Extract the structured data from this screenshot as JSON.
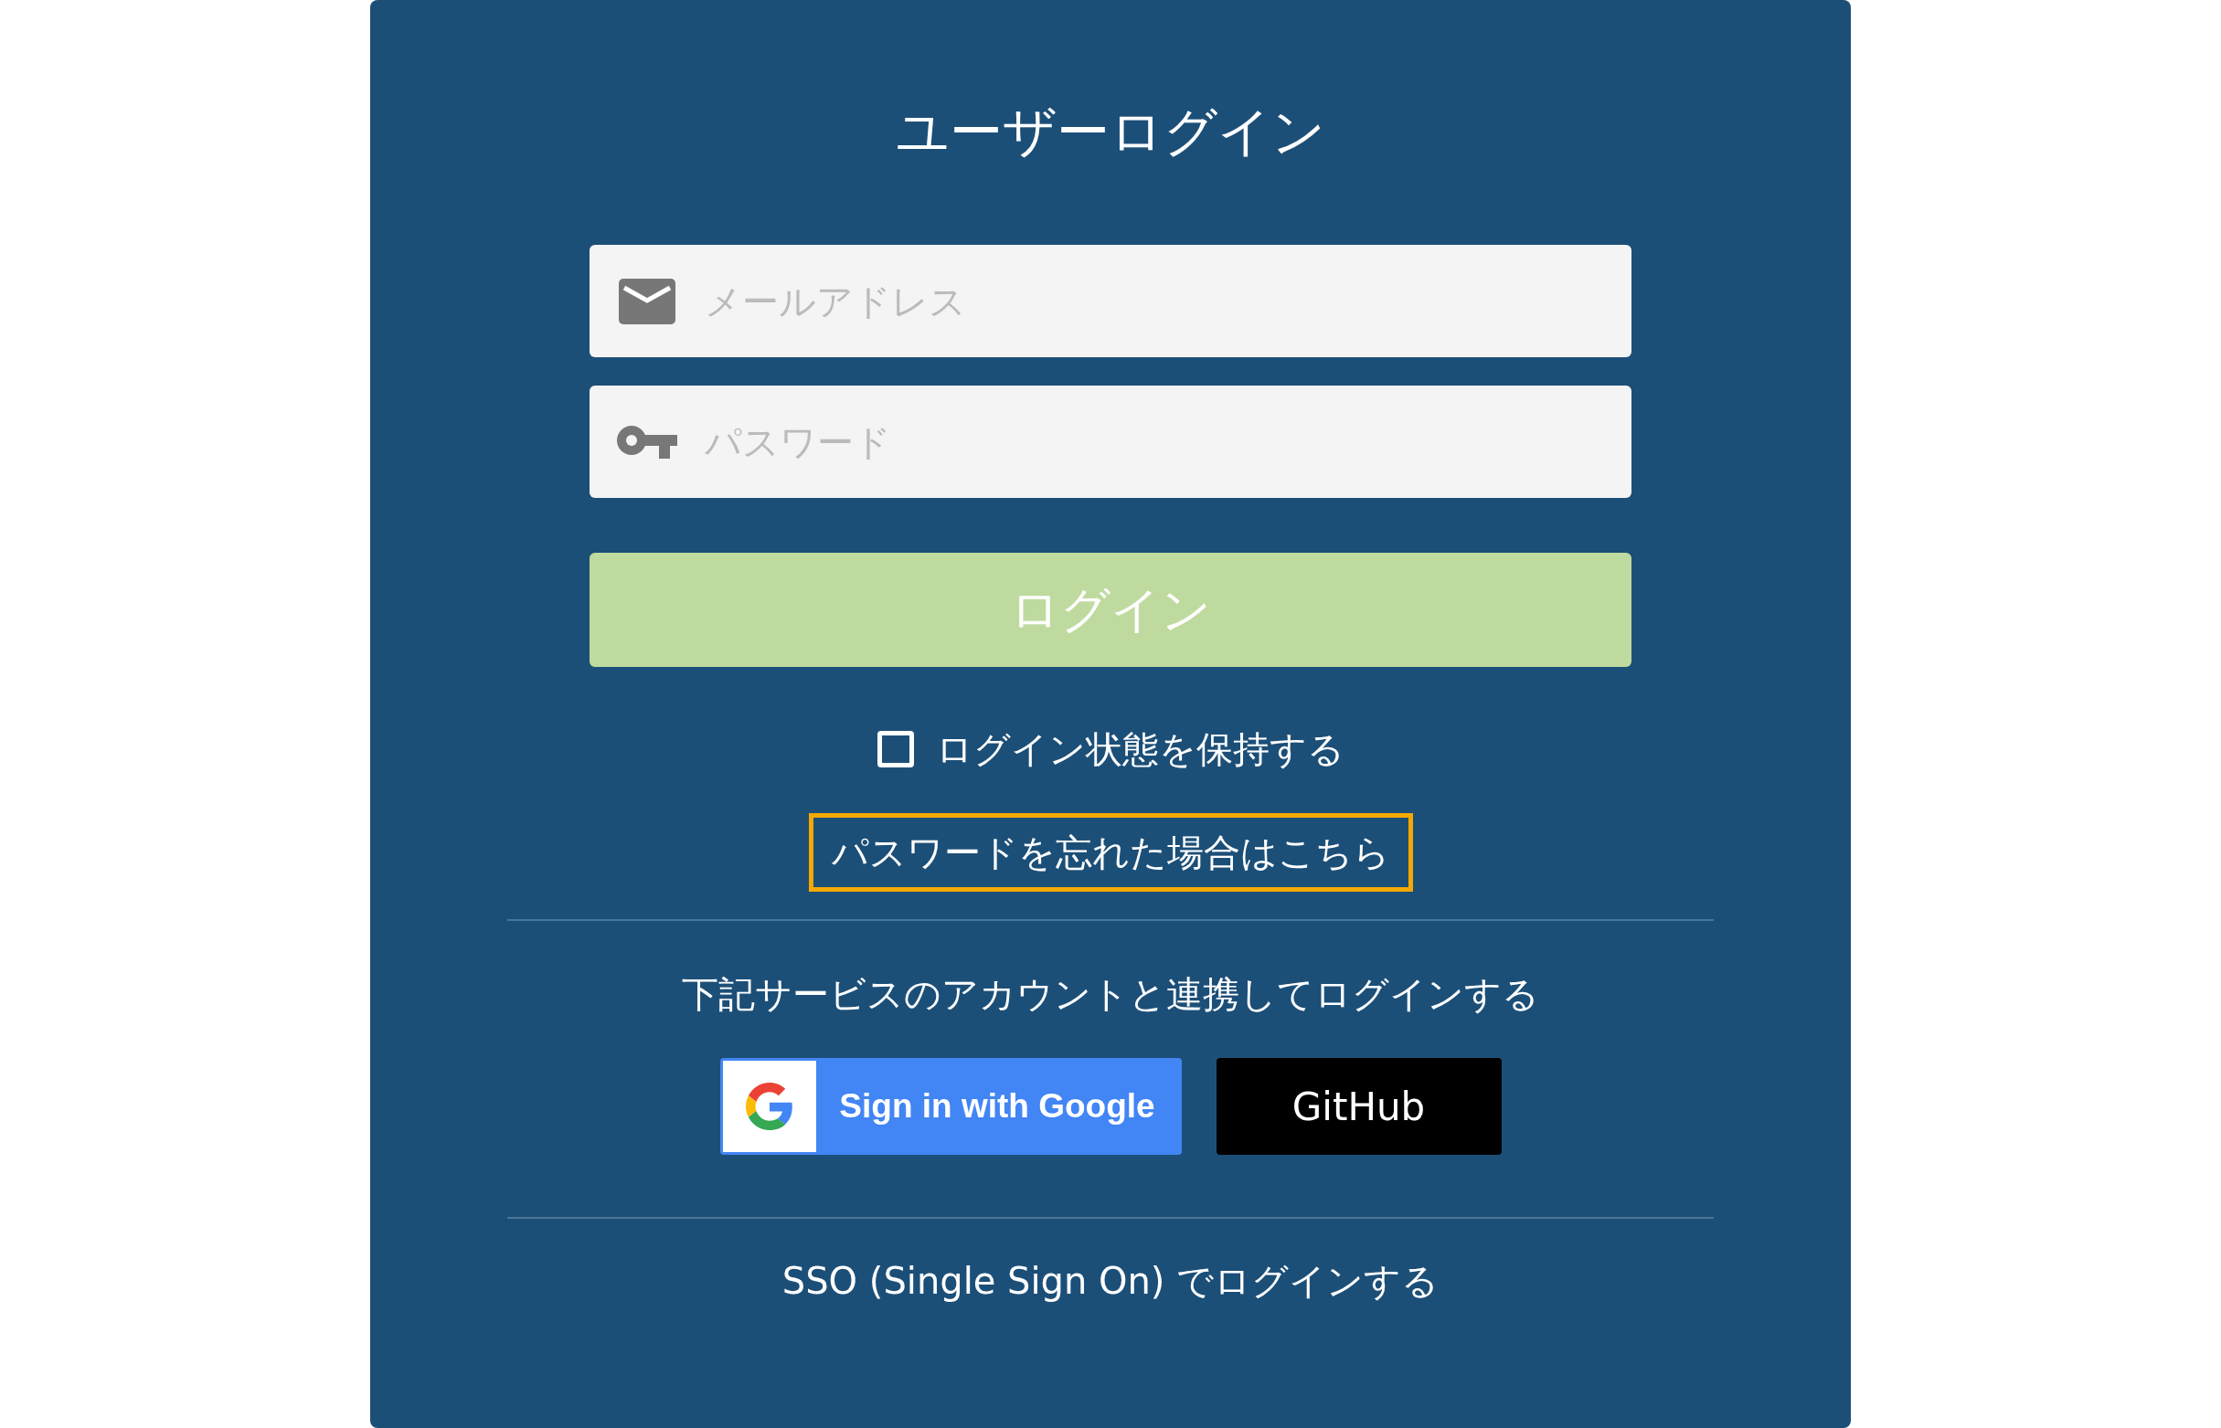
{
  "title": "ユーザーログイン",
  "email_field": {
    "placeholder": "メールアドレス"
  },
  "password_field": {
    "placeholder": "パスワード"
  },
  "login_button": {
    "label": "ログイン",
    "disabled": true
  },
  "remember_me": {
    "label": "ログイン状態を保持する",
    "checked": false
  },
  "forgot_link": {
    "label": "パスワードを忘れた場合はこちら",
    "focused": true
  },
  "social_prompt": "下記サービスのアカウントと連携してログインする",
  "social_buttons": [
    {
      "kind": "google",
      "label": "Sign in with Google"
    },
    {
      "kind": "github",
      "label": "GitHub"
    }
  ],
  "sso_link": "SSO (Single Sign On) でログインする"
}
